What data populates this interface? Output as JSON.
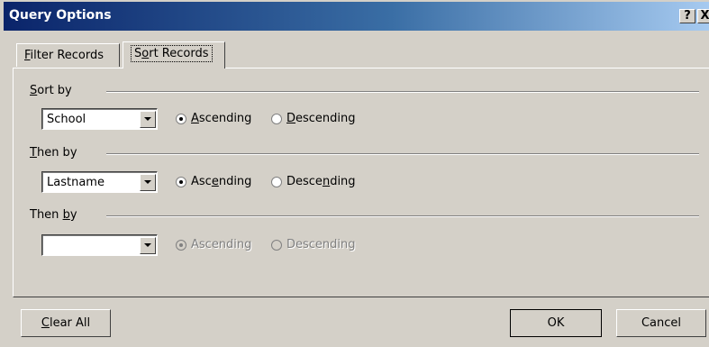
{
  "window": {
    "title": "Query Options",
    "help_label": "?",
    "close_label": "X"
  },
  "tabs": [
    {
      "label_pre": "",
      "mnemonic": "F",
      "label_post": "ilter Records",
      "active": false
    },
    {
      "label_pre": "S",
      "mnemonic": "o",
      "label_post": "rt Records",
      "active": true
    }
  ],
  "groups": [
    {
      "label_pre": "",
      "mnemonic": "S",
      "label_post": "ort by",
      "field_value": "School",
      "enabled": true,
      "ascending": {
        "pre": "",
        "mnemonic": "A",
        "post": "scending",
        "checked": true
      },
      "descending": {
        "pre": "",
        "mnemonic": "D",
        "post": "escending",
        "checked": false
      }
    },
    {
      "label_pre": "",
      "mnemonic": "T",
      "label_post": "hen by",
      "field_value": "Lastname",
      "enabled": true,
      "ascending": {
        "pre": "Asc",
        "mnemonic": "e",
        "post": "nding",
        "checked": true
      },
      "descending": {
        "pre": "Desce",
        "mnemonic": "n",
        "post": "ding",
        "checked": false
      }
    },
    {
      "label_pre": "Then ",
      "mnemonic": "b",
      "label_post": "y",
      "field_value": "",
      "enabled": false,
      "ascending": {
        "pre": "Ascending",
        "mnemonic": "",
        "post": "",
        "checked": true
      },
      "descending": {
        "pre": "Descending",
        "mnemonic": "",
        "post": "",
        "checked": false
      }
    }
  ],
  "buttons": {
    "clear_all": {
      "pre": "",
      "mnemonic": "C",
      "post": "lear All"
    },
    "ok": "OK",
    "cancel": "Cancel"
  }
}
